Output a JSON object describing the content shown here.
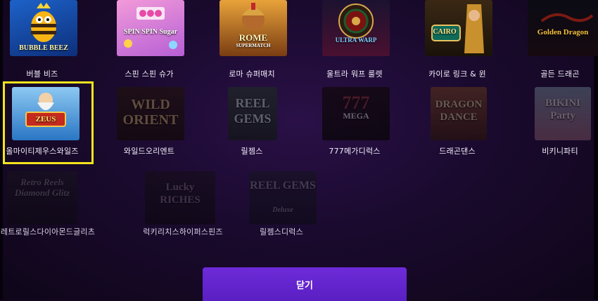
{
  "games": {
    "row1": [
      {
        "label": "버블 비즈",
        "art": "BUBBLE BEEZ",
        "icon": "bee-mascot-icon"
      },
      {
        "label": "스핀 스핀 슈가",
        "art": "SPIN SPIN Sugar",
        "icon": "candy-icon"
      },
      {
        "label": "로마 슈퍼매치",
        "art": "ROME",
        "art_sub": "SUPERMATCH",
        "icon": "roman-helmet-icon"
      },
      {
        "label": "울트라 워프 룰렛",
        "art": "ULTRA WARP",
        "icon": "roulette-wheel-icon"
      },
      {
        "label": "카이로 링크 & 윈",
        "art": "CAIRO",
        "icon": "pharaoh-icon"
      },
      {
        "label": "골든 드래곤",
        "art": "Golden Dragon",
        "icon": "dragon-icon"
      }
    ],
    "row2": [
      {
        "label": "올마이티제우스와일즈",
        "art": "ZEUS",
        "icon": "zeus-icon"
      },
      {
        "label": "와일드오리엔트",
        "art": "WILD ORIENT",
        "icon": "lantern-icon"
      },
      {
        "label": "릴젬스",
        "art": "REEL GEMS",
        "icon": "gem-icon"
      },
      {
        "label": "777메가디럭스",
        "art": "777",
        "art_sub": "MEGA",
        "icon": "seven-icon"
      },
      {
        "label": "드래곤댄스",
        "art": "DRAGON DANCE",
        "icon": "dragon-dance-icon"
      },
      {
        "label": "비키니파티",
        "art": "BIKINI Party",
        "icon": "beach-icon"
      }
    ],
    "row3": [
      {
        "label": "레트로릴스다이아몬드글리츠",
        "art": "Retro Reels Diamond Glitz",
        "icon": "diamond-icon"
      },
      {
        "label": "럭키리치스하이퍼스핀즈",
        "art": "Lucky RICHES",
        "icon": "clover-icon"
      },
      {
        "label": "릴젬스디럭스",
        "art": "REEL GEMS",
        "art_sub": "Deluxe",
        "icon": "gem-icon"
      }
    ]
  },
  "close_button": {
    "label": "닫기"
  }
}
